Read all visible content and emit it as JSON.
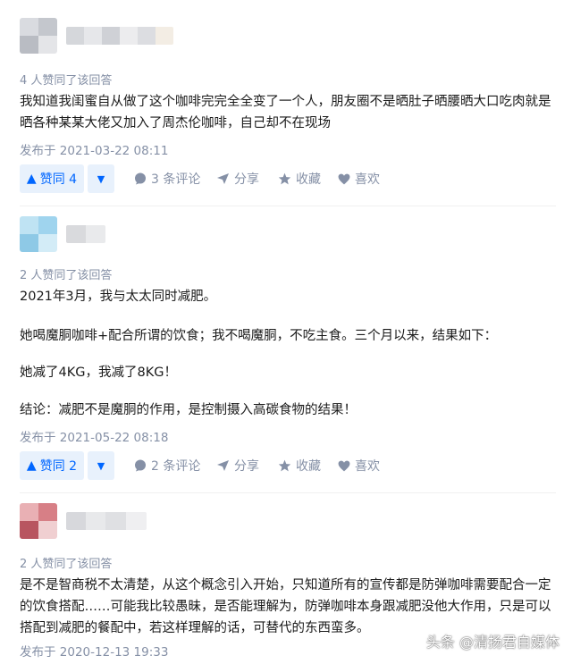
{
  "answers": [
    {
      "votes_text": "4 人赞同了该回答",
      "paragraphs": [
        "我知道我闺蜜自从做了这个咖啡完完全全变了一个人，朋友圈不是晒肚子晒腰晒大口吃肉就是晒各种某某大佬又加入了周杰伦咖啡，自己却不在现场"
      ],
      "date": "发布于 2021-03-22 08:11",
      "upvote_label": "赞同 4",
      "comment_label": "3 条评论",
      "share_label": "分享",
      "favorite_label": "收藏",
      "like_label": "喜欢"
    },
    {
      "votes_text": "2 人赞同了该回答",
      "paragraphs": [
        "2021年3月，我与太太同时减肥。",
        "她喝魔胴咖啡+配合所谓的饮食；我不喝魔胴，不吃主食。三个月以来，结果如下：",
        "她减了4KG，我减了8KG！",
        "结论：减肥不是魔胴的作用，是控制摄入高碳食物的结果！"
      ],
      "date": "发布于 2021-05-22 08:18",
      "upvote_label": "赞同 2",
      "comment_label": "2 条评论",
      "share_label": "分享",
      "favorite_label": "收藏",
      "like_label": "喜欢"
    },
    {
      "votes_text": "2 人赞同了该回答",
      "paragraphs": [
        "是不是智商税不太清楚，从这个概念引入开始，只知道所有的宣传都是防弹咖啡需要配合一定的饮食搭配……可能我比较愚昧，是否能理解为，防弹咖啡本身跟减肥没他大作用，只是可以搭配到减肥的餐配中，若这样理解的话，可替代的东西蛮多。"
      ],
      "date": "发布于 2020-12-13 19:33"
    }
  ],
  "watermark": "头条 @清扬君自媒体",
  "colors": {
    "accent": "#0066ff",
    "accent_bg": "#e8f1fc",
    "meta": "#8590a6"
  }
}
